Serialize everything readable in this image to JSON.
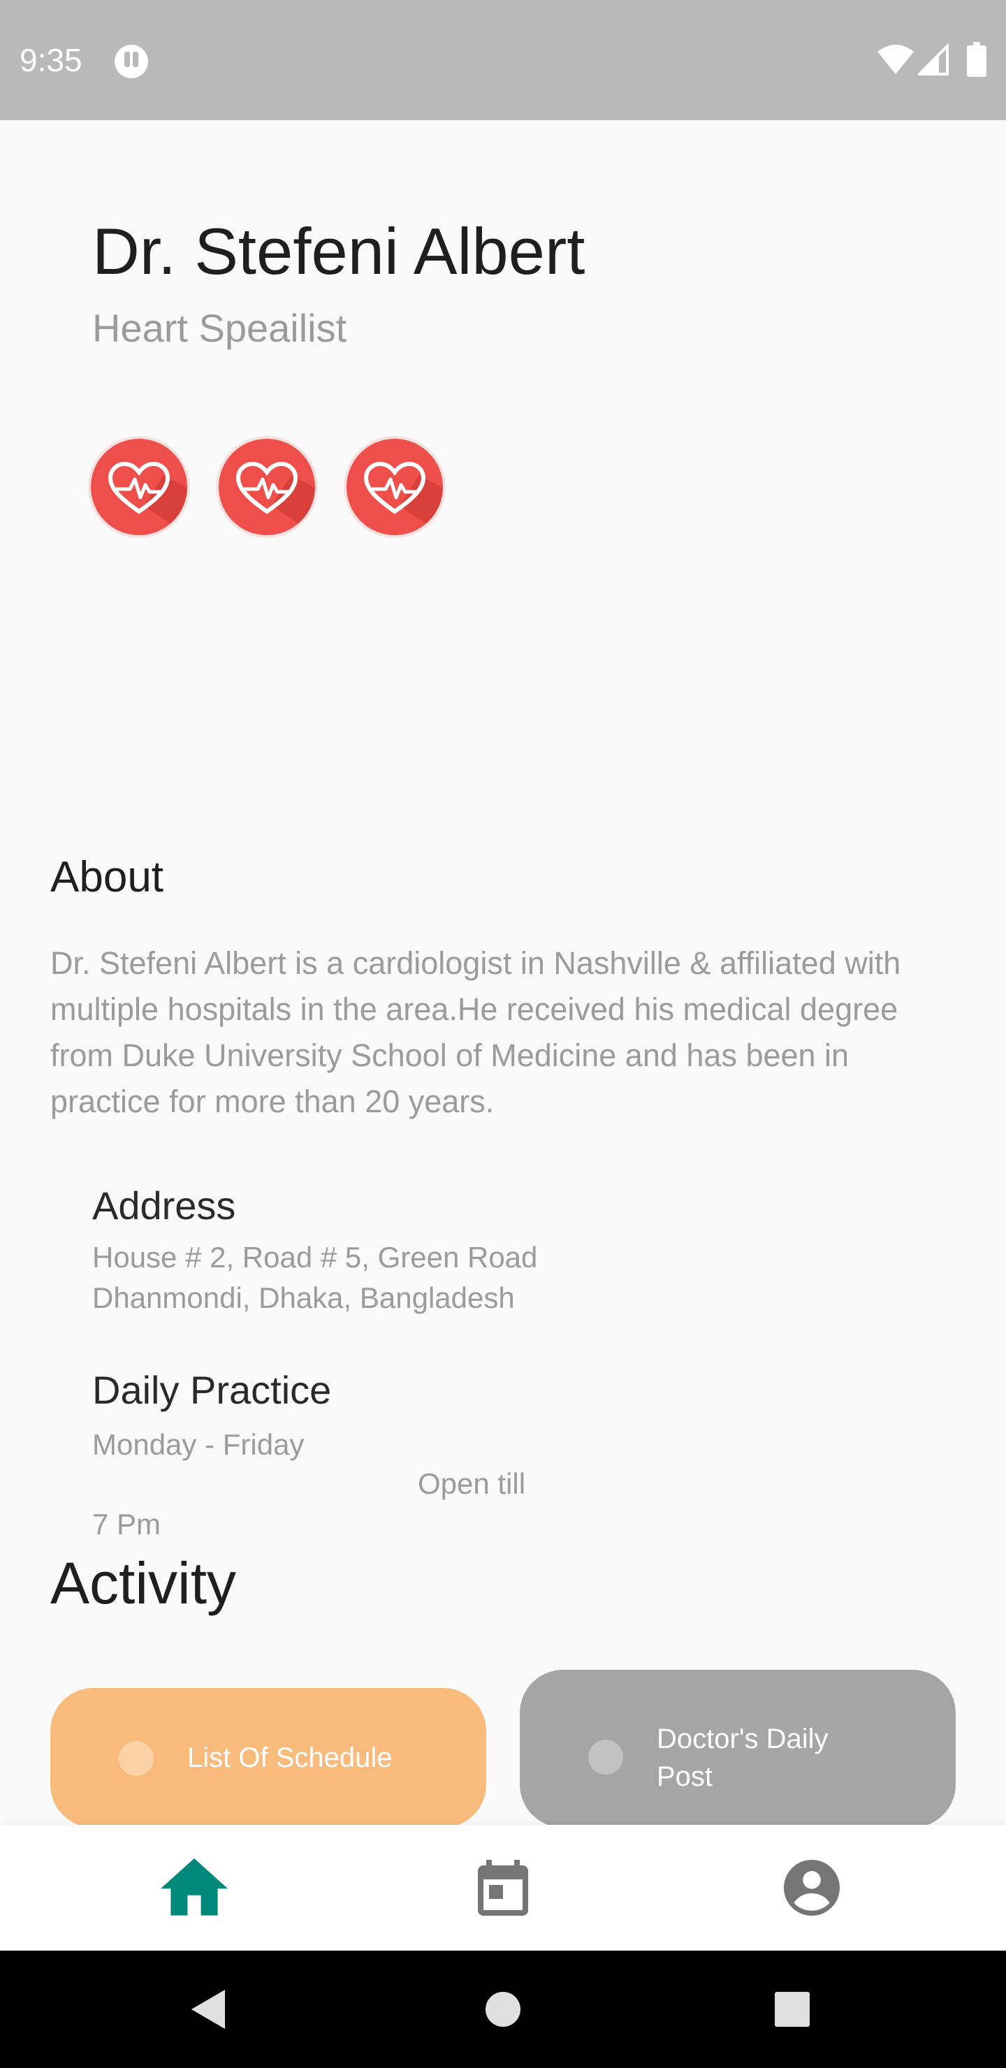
{
  "status_bar": {
    "time": "9:35"
  },
  "doctor": {
    "name": "Dr. Stefeni Albert",
    "specialty": "Heart Speailist",
    "badges": [
      "heart-rate-icon",
      "heart-rate-icon",
      "heart-rate-icon"
    ]
  },
  "about": {
    "title": "About",
    "text": "Dr. Stefeni Albert is a cardiologist in Nashville & affiliated with multiple hospitals in the  area.He received his medical degree from Duke University School of Medicine and has been in practice for more than 20 years."
  },
  "address": {
    "title": "Address",
    "line1": "House # 2, Road # 5, Green Road",
    "line2": "Dhanmondi, Dhaka, Bangladesh"
  },
  "daily_practice": {
    "title": "Daily Practice",
    "days": "Monday - Friday",
    "open_label": "Open till",
    "close_time": "7 Pm"
  },
  "activity": {
    "title": "Activity",
    "cards": [
      {
        "label": "List Of Schedule",
        "color": "#f9bb7c"
      },
      {
        "label": "Doctor's Daily Post",
        "color": "#a5a5a5"
      }
    ]
  },
  "bottom_nav": {
    "items": [
      {
        "icon": "home-icon",
        "active": true
      },
      {
        "icon": "calendar-icon",
        "active": false
      },
      {
        "icon": "account-icon",
        "active": false
      }
    ],
    "active_color": "#00897b",
    "inactive_color": "#757575"
  },
  "colors": {
    "badge": "#ef4f4b",
    "status_bar": "#b9b9b9"
  }
}
